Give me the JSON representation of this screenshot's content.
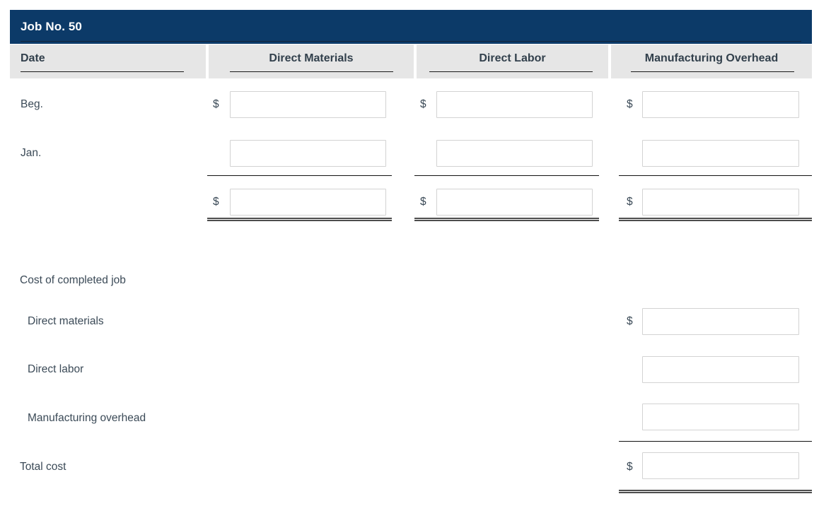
{
  "job_card": {
    "title": "Job No. 50",
    "currency_symbol": "$",
    "columns": [
      {
        "key": "date",
        "label": "Date",
        "align": "left"
      },
      {
        "key": "direct_materials",
        "label": "Direct Materials",
        "align": "center"
      },
      {
        "key": "direct_labor",
        "label": "Direct Labor",
        "align": "center"
      },
      {
        "key": "manufacturing_overhead",
        "label": "Manufacturing Overhead",
        "align": "center"
      }
    ],
    "rows": [
      {
        "label": "Beg.",
        "show_dollar": true,
        "direct_materials": "",
        "direct_labor": "",
        "manufacturing_overhead": ""
      },
      {
        "label": "Jan.",
        "show_dollar": false,
        "direct_materials": "",
        "direct_labor": "",
        "manufacturing_overhead": ""
      },
      {
        "label": "",
        "show_dollar": true,
        "is_total": true,
        "direct_materials": "",
        "direct_labor": "",
        "manufacturing_overhead": ""
      }
    ]
  },
  "completed_job": {
    "section_title": "Cost of completed job",
    "items": [
      {
        "label": "Direct materials",
        "show_dollar": true,
        "value": ""
      },
      {
        "label": "Direct labor",
        "show_dollar": false,
        "value": ""
      },
      {
        "label": "Manufacturing overhead",
        "show_dollar": false,
        "value": ""
      }
    ],
    "total": {
      "label": "Total cost",
      "show_dollar": true,
      "value": ""
    }
  },
  "input_placeholder": "",
  "colors": {
    "header_bar": "#0c3a68",
    "header_band": "#e6e6e6",
    "text": "#3b4a57",
    "input_border": "#d3d3d3",
    "rule": "#111111",
    "double_rule": "#4d4d4d"
  }
}
